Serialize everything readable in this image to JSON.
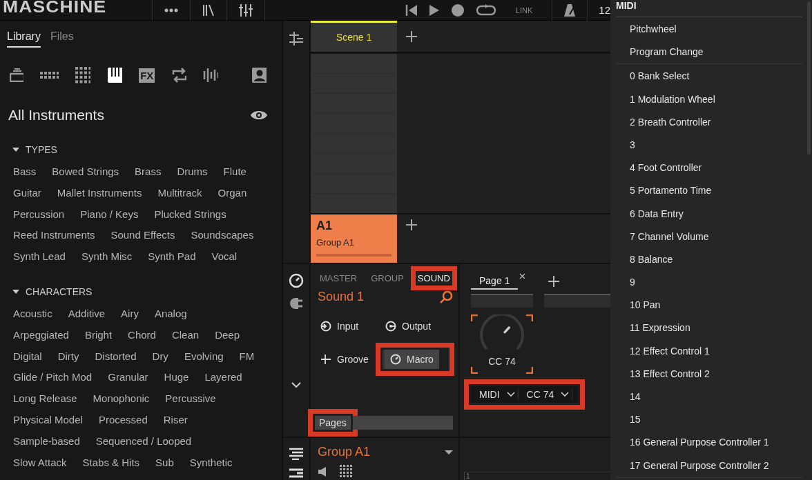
{
  "top_bar": {
    "logo": "MASCHINE",
    "link": "LINK",
    "tempo": "12"
  },
  "browser": {
    "tabs": [
      {
        "label": "Library",
        "selected": true
      },
      {
        "label": "Files",
        "selected": false
      }
    ],
    "filters": [
      {
        "kind": "stack",
        "selected": false
      },
      {
        "kind": "dots",
        "selected": false
      },
      {
        "kind": "grid",
        "selected": false
      },
      {
        "kind": "piano",
        "selected": true
      },
      {
        "kind": "fx",
        "label": "FX",
        "selected": false
      },
      {
        "kind": "loop",
        "selected": false
      },
      {
        "kind": "wave",
        "selected": false
      },
      {
        "kind": "user",
        "selected": false
      }
    ],
    "title": "All Instruments",
    "sections": [
      {
        "title": "TYPES",
        "expanded": true,
        "tags": [
          "Bass",
          "Bowed Strings",
          "Brass",
          "Drums",
          "Flute",
          "Guitar",
          "Mallet Instruments",
          "Multitrack",
          "Organ",
          "Percussion",
          "Piano / Keys",
          "Plucked Strings",
          "Reed Instruments",
          "Sound Effects",
          "Soundscapes",
          "Synth Lead",
          "Synth Misc",
          "Synth Pad",
          "Vocal"
        ]
      },
      {
        "title": "CHARACTERS",
        "expanded": true,
        "tags": [
          "Acoustic",
          "Additive",
          "Airy",
          "Analog",
          "Arpeggiated",
          "Bright",
          "Chord",
          "Clean",
          "Deep",
          "Digital",
          "Dirty",
          "Distorted",
          "Dry",
          "Evolving",
          "FM",
          "Glide / Pitch Mod",
          "Granular",
          "Huge",
          "Layered",
          "Long Release",
          "Monophonic",
          "Percussive",
          "Physical Model",
          "Processed",
          "Riser",
          "Sample-based",
          "Sequenced / Looped",
          "Slow Attack",
          "Stabs & Hits",
          "Sub",
          "Synthetic"
        ]
      }
    ]
  },
  "arranger": {
    "scenes": [
      {
        "label": "Scene 1",
        "selected": true
      }
    ],
    "groups": [
      {
        "code": "A1",
        "name": "Group A1",
        "selected": true
      }
    ]
  },
  "sound_panel": {
    "tabs": [
      {
        "label": "MASTER",
        "selected": false,
        "highlighted": false
      },
      {
        "label": "GROUP",
        "selected": false,
        "highlighted": false
      },
      {
        "label": "SOUND",
        "selected": true,
        "highlighted": true
      }
    ],
    "sound_name": "Sound 1",
    "buttons": [
      {
        "label": "Input",
        "kind": "input",
        "selected": false,
        "highlighted": false
      },
      {
        "label": "Output",
        "kind": "output",
        "selected": false,
        "highlighted": false
      },
      {
        "label": "Groove",
        "kind": "groove",
        "selected": false,
        "highlighted": false
      },
      {
        "label": "Macro",
        "kind": "macro",
        "selected": true,
        "highlighted": true
      }
    ],
    "pages": {
      "label": "Pages",
      "highlighted": true
    }
  },
  "macro_page": {
    "tabs": [
      {
        "label": "Page 1",
        "selected": true
      }
    ],
    "knob": {
      "label": "CC 74",
      "level": 0.66,
      "focused": true
    },
    "source": {
      "highlighted": true,
      "parts": [
        "MIDI",
        "CC 74"
      ]
    }
  },
  "footer": {
    "group": "Group A1",
    "ruler": [
      "1"
    ]
  },
  "menu": {
    "title": "MIDI",
    "groups": [
      [
        "Pitchwheel",
        "Program Change"
      ],
      [
        "0 Bank Select",
        "1 Modulation Wheel",
        "2 Breath Controller",
        "3",
        "4 Foot Controller",
        "5 Portamento Time",
        "6 Data Entry",
        "7 Channel Volume",
        "8 Balance",
        "9",
        "10 Pan",
        "11 Expression",
        "12 Effect Control 1",
        "13 Effect Control 2",
        "14",
        "15",
        "16 General Purpose Controller 1",
        "17 General Purpose Controller 2"
      ]
    ]
  }
}
